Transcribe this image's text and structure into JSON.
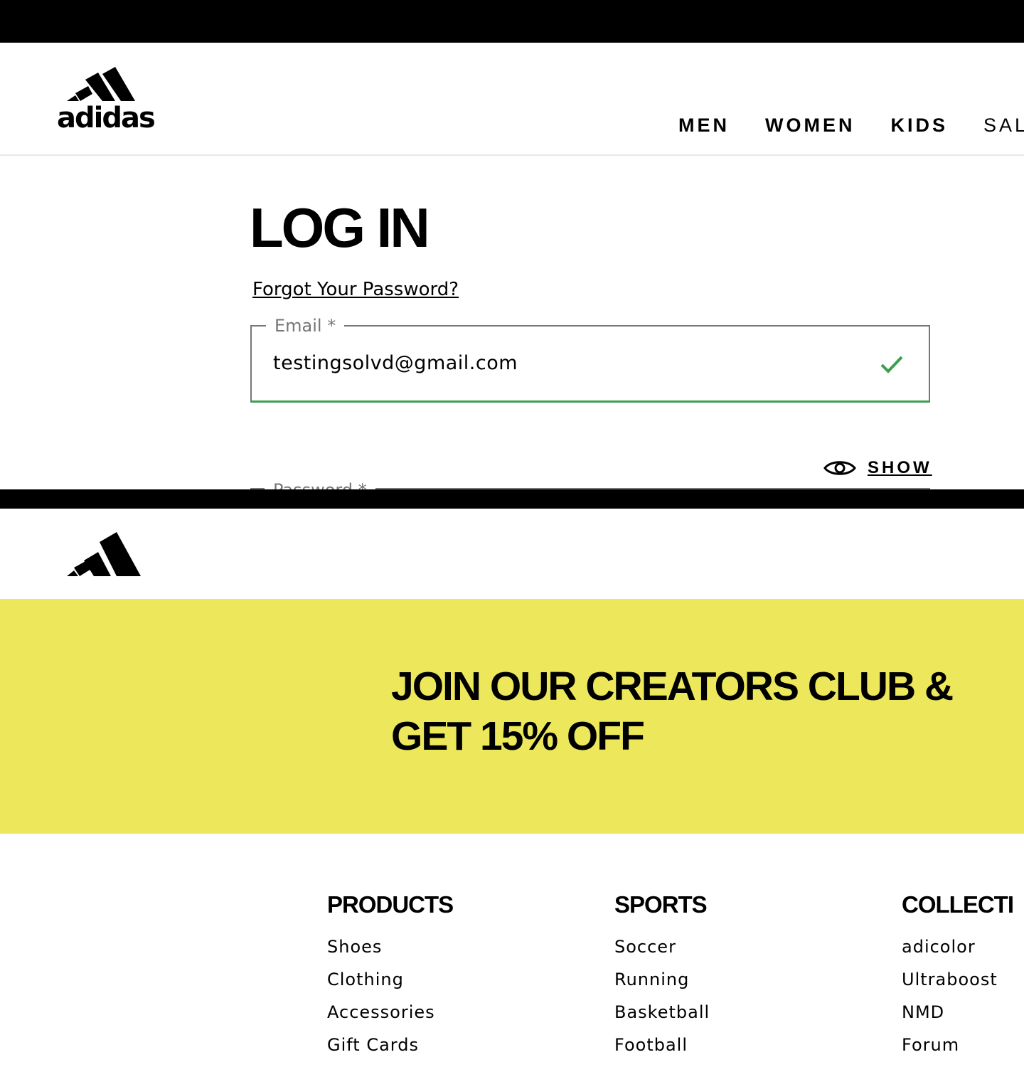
{
  "header": {
    "logo_text": "adidas",
    "nav": [
      "MEN",
      "WOMEN",
      "KIDS",
      "SAL"
    ]
  },
  "login": {
    "title": "LOG IN",
    "forgot_password": "Forgot Your Password?",
    "email_label": "Email *",
    "email_value": "testingsolvd@gmail.com",
    "show_label": "SHOW",
    "password_label": "Password *"
  },
  "promo": {
    "line1": "JOIN OUR CREATORS CLUB &",
    "line2": "GET 15% OFF"
  },
  "footer": {
    "products": {
      "title": "PRODUCTS",
      "links": [
        "Shoes",
        "Clothing",
        "Accessories",
        "Gift Cards"
      ]
    },
    "sports": {
      "title": "SPORTS",
      "links": [
        "Soccer",
        "Running",
        "Basketball",
        "Football"
      ]
    },
    "collections": {
      "title": "COLLECTI",
      "links": [
        "adicolor",
        "Ultraboost",
        "NMD",
        "Forum"
      ]
    }
  },
  "colors": {
    "valid_green": "#3c9e51",
    "promo_yellow": "#ede85b",
    "border_grey": "#767677"
  }
}
